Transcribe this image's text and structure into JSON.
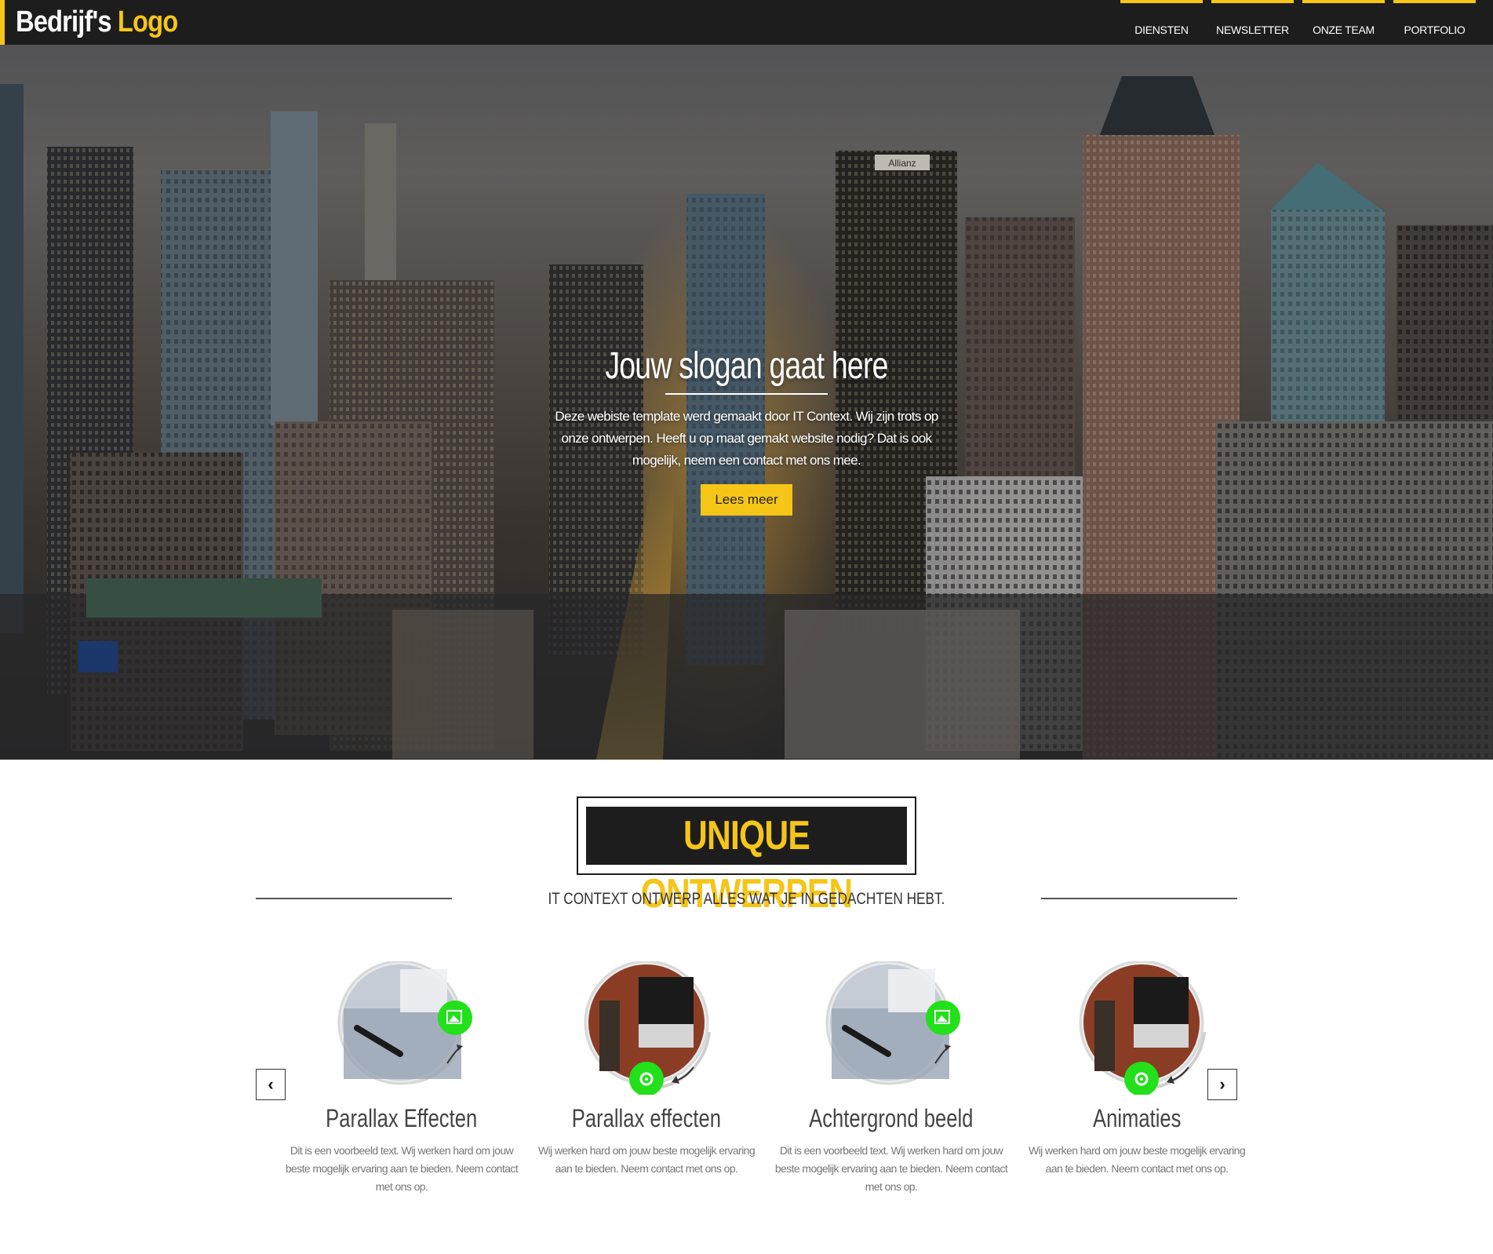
{
  "header": {
    "logo_prefix": "Bedrijf's",
    "logo_suffix": "Logo",
    "nav": [
      {
        "label": "DIENSTEN"
      },
      {
        "label": "NEWSLETTER"
      },
      {
        "label": "ONZE TEAM"
      },
      {
        "label": "PORTFOLIO"
      }
    ]
  },
  "hero": {
    "slogan": "Jouw slogan gaat here",
    "text": "Deze webiste template werd gemaakt door IT Context. Wij zijn trots op onze ontwerpen. Heeft u op maat gemakt website nodig? Dat is ook mogelijk, neem een contact met ons mee.",
    "button_label": "Lees meer",
    "sign_text": "Allianz"
  },
  "section": {
    "badge": "UNIQUE ONTWERPEN",
    "subtitle": "IT CONTEXT ONTWERP ALLES WAT JE IN GEDACHTEN HEBT.",
    "prev_arrow": "‹",
    "next_arrow": "›",
    "cards": [
      {
        "title": "Parallax Effecten",
        "text": "Dit is een voorbeeld text. Wij werken hard om jouw beste mogelijk ervaring aan te bieden. Neem contact met ons op.",
        "image": "desk-pen",
        "icon": "image-icon"
      },
      {
        "title": "Parallax effecten",
        "text": "Wij werken hard om jouw beste mogelijk ervaring aan te bieden. Neem contact met ons op.",
        "image": "laptop-brick",
        "icon": "gear-icon"
      },
      {
        "title": "Achtergrond beeld",
        "text": "Dit is een voorbeeld text. Wij werken hard om jouw beste mogelijk ervaring aan te bieden. Neem contact met ons op.",
        "image": "desk-pen",
        "icon": "image-icon"
      },
      {
        "title": "Animaties",
        "text": "Wij werken hard om jouw beste mogelijk ervaring aan te bieden. Neem contact met ons op.",
        "image": "laptop-brick",
        "icon": "gear-icon"
      }
    ]
  },
  "colors": {
    "accent": "#f5c518",
    "dark": "#1d1d1d",
    "icon_green": "#22e01a"
  }
}
